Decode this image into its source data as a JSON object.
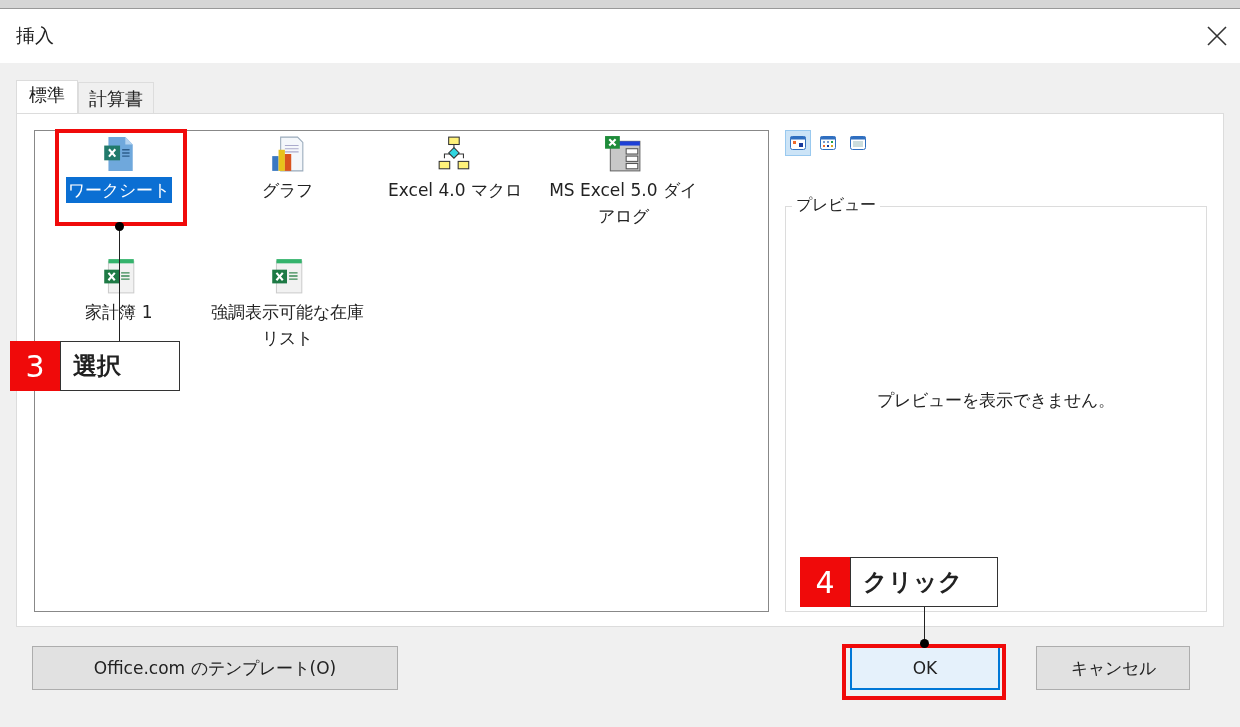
{
  "window": {
    "title": "挿入"
  },
  "tabs": [
    {
      "label": "標準",
      "selected": true
    },
    {
      "label": "計算書",
      "selected": false
    }
  ],
  "items": [
    {
      "label": "ワークシート",
      "kind": "worksheet",
      "selected": true
    },
    {
      "label": "グラフ",
      "kind": "chart",
      "selected": false
    },
    {
      "label": "Excel 4.0 マクロ",
      "kind": "macro",
      "selected": false
    },
    {
      "label": "MS Excel 5.0 ダイアログ",
      "kind": "dialog",
      "selected": false
    },
    {
      "label": "家計簿 1",
      "kind": "template",
      "selected": false
    },
    {
      "label": "強調表示可能な在庫リスト",
      "kind": "template",
      "selected": false
    }
  ],
  "view_buttons": [
    {
      "kind": "large",
      "selected": true
    },
    {
      "kind": "list",
      "selected": false
    },
    {
      "kind": "details",
      "selected": false
    }
  ],
  "preview": {
    "label": "プレビュー",
    "message": "プレビューを表示できません。"
  },
  "buttons": [
    {
      "label": "Office.com のテンプレート(O)",
      "kind": "template"
    },
    {
      "label": "OK",
      "kind": "ok"
    },
    {
      "label": "キャンセル",
      "kind": "cancel"
    }
  ],
  "annotations": [
    {
      "number": "3",
      "label": "選択"
    },
    {
      "number": "4",
      "label": "クリック"
    }
  ]
}
